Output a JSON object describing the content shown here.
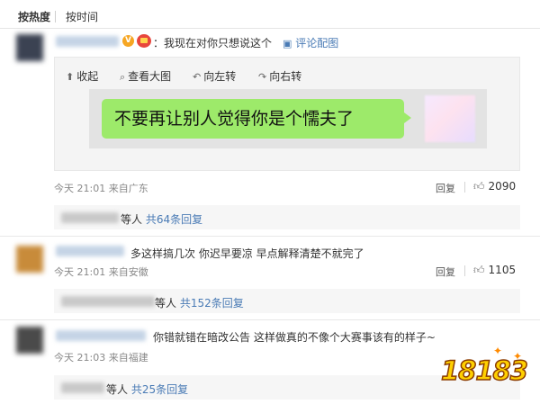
{
  "sort_tabs": {
    "hot": "按热度",
    "time": "按时间"
  },
  "viewer_tools": {
    "collapse": "收起",
    "view_large": "查看大图",
    "rotate_left": "向左转",
    "rotate_right": "向右转"
  },
  "comments": [
    {
      "text": "：我现在对你只想说这个",
      "image_link": "评论配图",
      "image_chat_text": "不要再让别人觉得你是个懦夫了",
      "meta": "今天 21:01 来自广东",
      "reply_label": "回复",
      "likes": "2090",
      "sub_suffix": "等人",
      "sub_count": "共64条回复"
    },
    {
      "text": "多这样搞几次 你迟早要凉 早点解释清楚不就完了",
      "meta": "今天 21:01 来自安徽",
      "reply_label": "回复",
      "likes": "1105",
      "sub_suffix": "等人",
      "sub_count": "共152条回复"
    },
    {
      "text": "你错就错在暗改公告 这样做真的不像个大赛事该有的样子~",
      "meta": "今天 21:03 来自福建",
      "sub_suffix": "等人",
      "sub_count": "共25条回复"
    }
  ],
  "watermark": "18183",
  "icons": {
    "collapse": "arrow-up-icon",
    "view_large": "search-icon",
    "rotate_left": "rotate-left-icon",
    "rotate_right": "rotate-right-icon",
    "image_link": "image-icon",
    "like": "thumbs-up-icon"
  },
  "colors": {
    "link": "#4a7bb5",
    "bubble": "#9dea6a",
    "watermark": "#ffd000"
  }
}
